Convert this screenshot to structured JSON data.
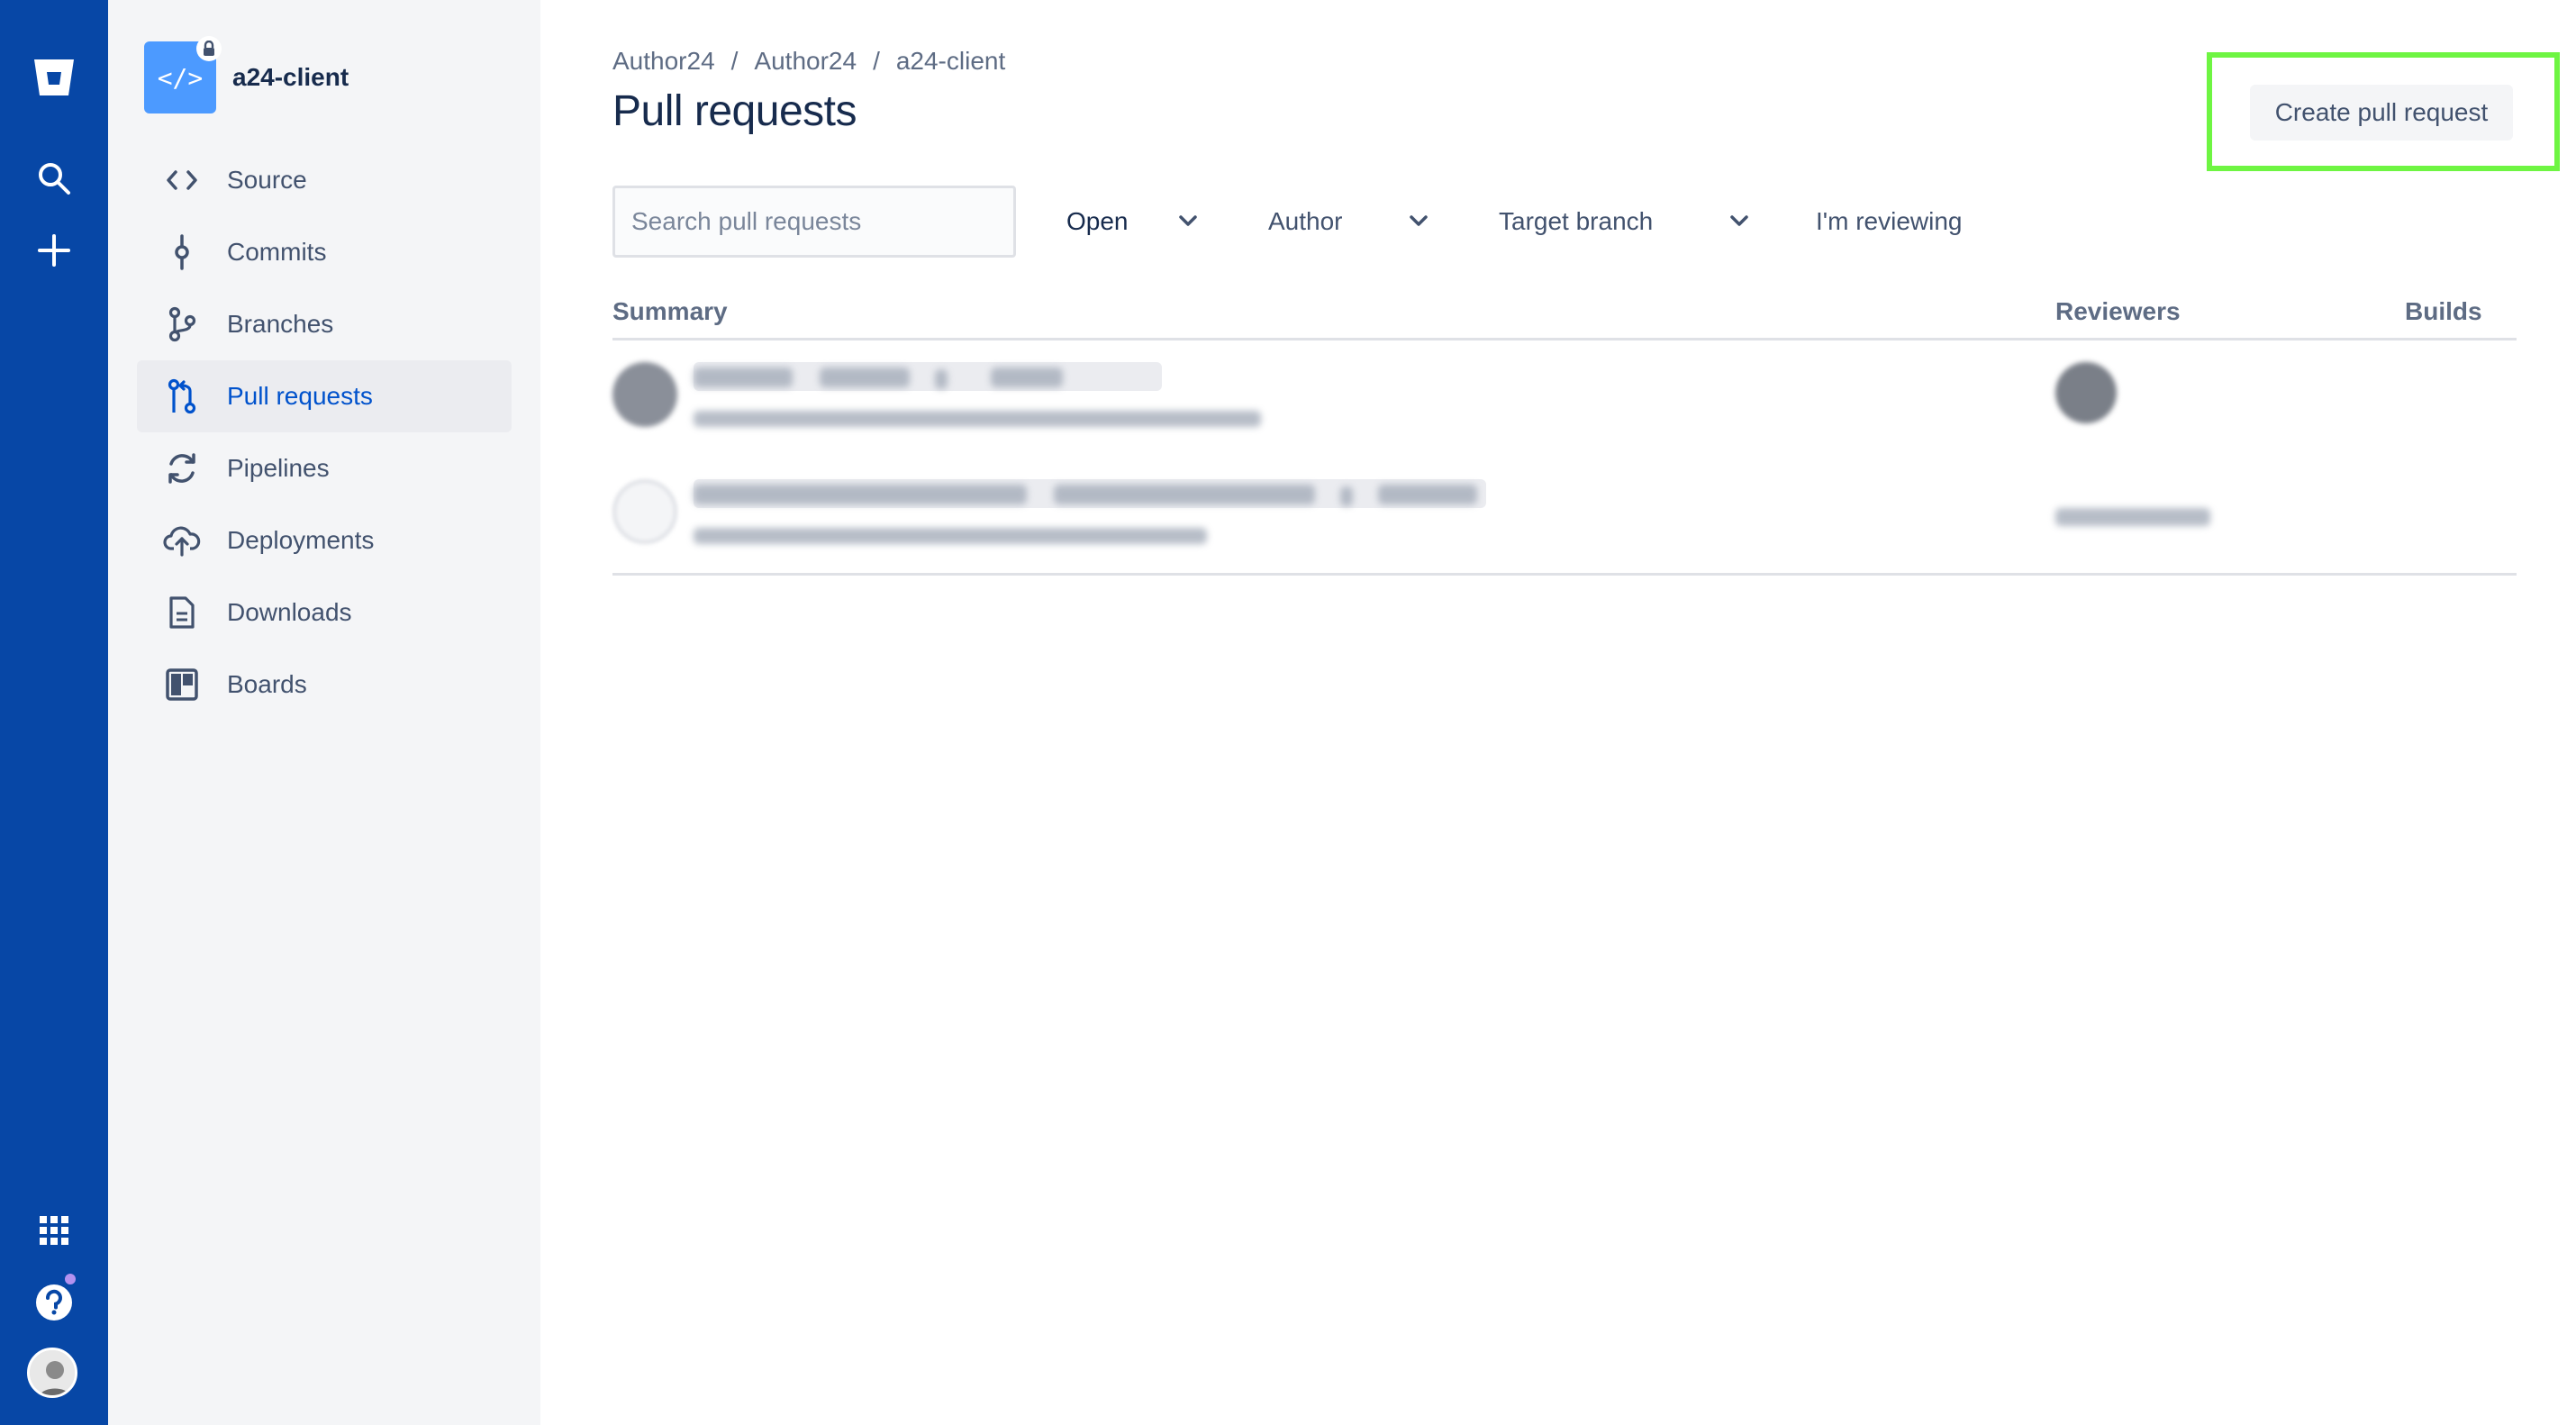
{
  "global_nav": {
    "items": [
      {
        "name": "bitbucket-logo-icon"
      },
      {
        "name": "search-icon"
      },
      {
        "name": "create-icon"
      },
      {
        "name": "app-switcher-icon"
      },
      {
        "name": "help-icon"
      },
      {
        "name": "profile-avatar"
      }
    ],
    "colors": {
      "background": "#0747a6"
    }
  },
  "sidebar": {
    "repo_name": "a24-client",
    "repo_icon_glyph": "</>",
    "items": [
      {
        "label": "Source",
        "icon": "code-icon"
      },
      {
        "label": "Commits",
        "icon": "commit-icon"
      },
      {
        "label": "Branches",
        "icon": "branch-icon"
      },
      {
        "label": "Pull requests",
        "icon": "pull-request-icon",
        "active": true
      },
      {
        "label": "Pipelines",
        "icon": "pipelines-icon"
      },
      {
        "label": "Deployments",
        "icon": "cloud-upload-icon"
      },
      {
        "label": "Downloads",
        "icon": "document-icon"
      },
      {
        "label": "Boards",
        "icon": "board-icon"
      }
    ]
  },
  "main": {
    "breadcrumb": [
      "Author24",
      "Author24",
      "a24-client"
    ],
    "breadcrumb_sep": "/",
    "title": "Pull requests",
    "create_button": "Create pull request",
    "search_placeholder": "Search pull requests",
    "filters": {
      "state": "Open",
      "author": "Author",
      "target_branch": "Target branch",
      "reviewing": "I'm reviewing"
    },
    "columns": {
      "summary": "Summary",
      "reviewers": "Reviewers",
      "builds": "Builds"
    }
  },
  "colors": {
    "accent": "#0052cc",
    "highlight": "#6ef542"
  }
}
